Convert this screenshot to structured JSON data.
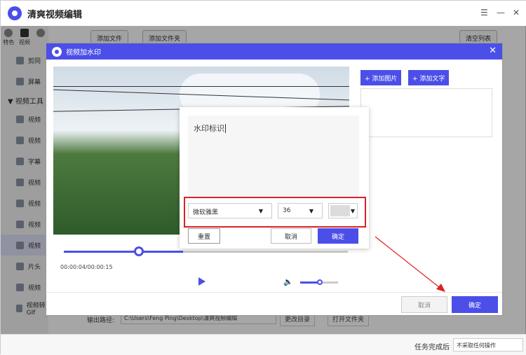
{
  "app": {
    "title": "清爽视频编辑"
  },
  "window": {
    "menu_glyph": "☰",
    "minimize_glyph": "—",
    "close_glyph": "✕"
  },
  "sidebar": {
    "tabs": [
      "特色",
      "视频",
      "",
      ""
    ],
    "items": [
      {
        "label": "剪同"
      },
      {
        "label": "屏幕"
      }
    ],
    "group_label": "▼  视频工具",
    "tool_items": [
      {
        "label": "视频"
      },
      {
        "label": "视频"
      },
      {
        "label": "字幕"
      },
      {
        "label": "视频"
      },
      {
        "label": "视频"
      },
      {
        "label": "视频"
      },
      {
        "label": "视频"
      },
      {
        "label": "片头"
      },
      {
        "label": "视频"
      },
      {
        "label": "视频转GIf"
      }
    ]
  },
  "toolbar": {
    "add_file": "添加文件",
    "add_folder": "添加文件夹",
    "clear_list": "清空列表"
  },
  "output": {
    "label": "输出路径:",
    "path": "C:\\Users\\Feng Ping\\Desktop\\清爽视频编辑",
    "change_dir": "更改目录",
    "open_folder": "打开文件夹"
  },
  "footer": {
    "after_done_label": "任务完成后",
    "after_done_value": "不采取任何操作"
  },
  "dialog": {
    "title": "视频加水印",
    "close_glyph": "✕",
    "add_image": "+ 添加图片",
    "add_text": "+ 添加文字",
    "timecode": "00:00:04/00:00:15",
    "playback_progress": 0.27,
    "volume_level": 0.55,
    "volume_glyph": "🔈",
    "cancel": "取消",
    "confirm": "确定"
  },
  "popup": {
    "text_value": "水印标识",
    "font": "微软雅黑",
    "size": "36",
    "color_hex": "#dcdcdc",
    "reset": "重置",
    "cancel": "取消",
    "confirm": "确定"
  },
  "colors": {
    "accent": "#4b4fe8",
    "highlight_box": "#d9222a",
    "arrow": "#e02020"
  }
}
